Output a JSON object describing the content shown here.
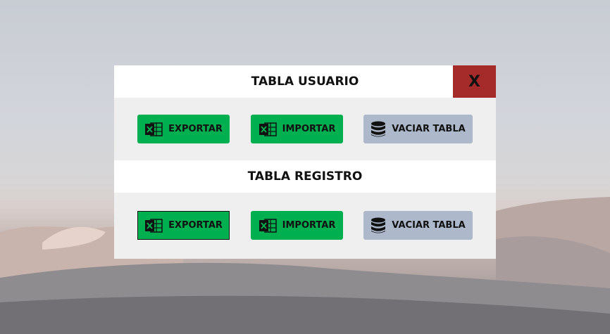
{
  "dialog": {
    "close_label": "X",
    "sections": [
      {
        "title": "TABLA USUARIO",
        "export_label": "EXPORTAR",
        "import_label": "IMPORTAR",
        "clear_label": "VACIAR TABLA"
      },
      {
        "title": "TABLA REGISTRO",
        "export_label": "EXPORTAR",
        "import_label": "IMPORTAR",
        "clear_label": "VACIAR TABLA"
      }
    ]
  },
  "colors": {
    "header_bg": "#ffffff",
    "panel_bg": "#efefef",
    "close_bg": "#a52a2a",
    "excel_button": "#00b050",
    "clear_button": "#adb9ca"
  },
  "icons": {
    "export": "excel-icon",
    "import": "excel-icon",
    "clear": "database-icon"
  }
}
